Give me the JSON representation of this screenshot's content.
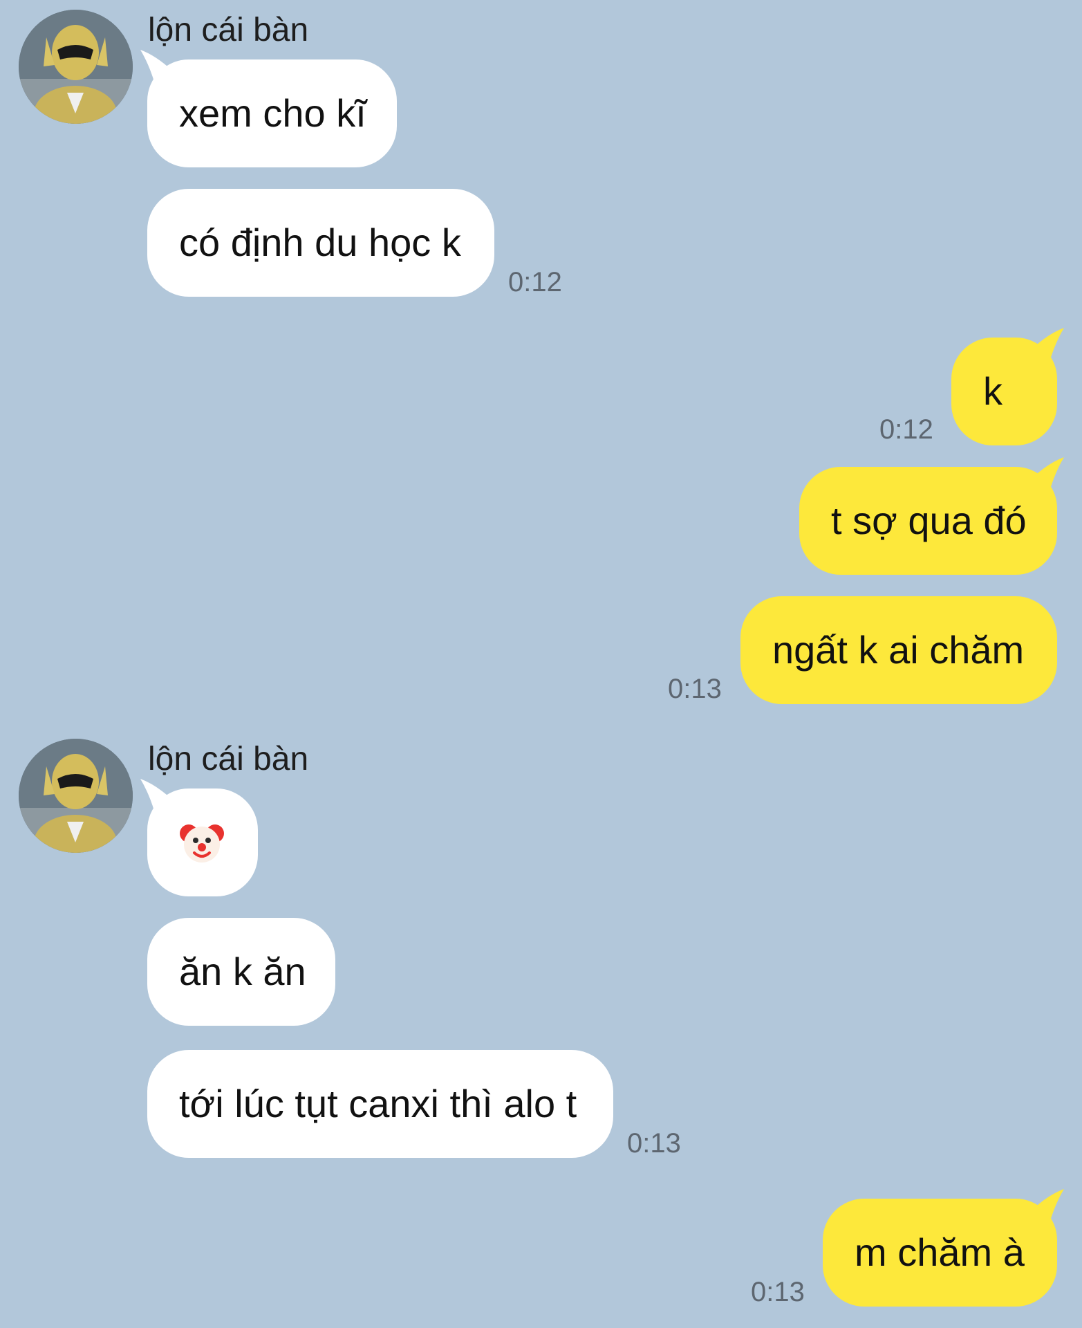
{
  "conversation": {
    "sender_name": "lộn cái bàn",
    "groups": [
      {
        "sender": "lộn cái bàn",
        "messages": [
          "xem cho kĩ",
          "có định du học k"
        ],
        "time": "0:12"
      },
      {
        "sender": "me",
        "messages": [
          "k"
        ],
        "time": "0:12"
      },
      {
        "sender": "me",
        "messages": [
          "t sợ qua đó",
          "ngất k ai chăm"
        ],
        "time": "0:13"
      },
      {
        "sender": "lộn cái bàn",
        "messages": [
          "clown-emoji",
          "ăn k ăn",
          "tới lúc tụt canxi thì alo t"
        ],
        "time": "0:13"
      },
      {
        "sender": "me",
        "messages": [
          "m chăm à"
        ],
        "time": "0:13"
      }
    ]
  },
  "colors": {
    "background": "#b2c7da",
    "incoming_bubble": "#ffffff",
    "outgoing_bubble": "#fde83b",
    "timestamp": "#5d6670"
  }
}
